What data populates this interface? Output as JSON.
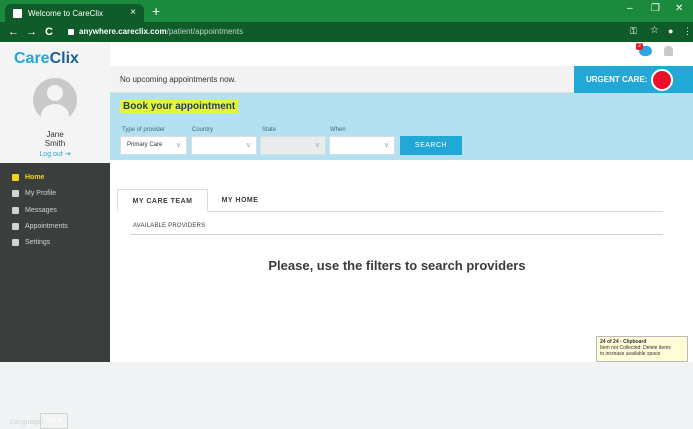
{
  "browser": {
    "tab_title": "Welcome to CareClix",
    "tab_close": "×",
    "new_tab": "+",
    "url_host": "anywhere.careclix.com",
    "url_path": "/patient/appointments",
    "minimize": "–",
    "restore": "❐",
    "close": "✕",
    "back": "←",
    "forward": "→",
    "reload": "C",
    "key": "⚿",
    "star": "☆",
    "profile": "●",
    "more": "⋮"
  },
  "sidebar": {
    "logo_a": "Care",
    "logo_b": "Clix",
    "user_first": "Jane",
    "user_last": "Smith",
    "logout": "Log out",
    "menu": [
      {
        "label": "Home"
      },
      {
        "label": "My Profile"
      },
      {
        "label": "Messages"
      },
      {
        "label": "Appointments"
      },
      {
        "label": "Settings"
      }
    ],
    "language_label": "Language:",
    "language_value": "EN ∨"
  },
  "header": {
    "notification_count": "2",
    "no_appointments": "No upcoming appointments now.",
    "urgent_care": "URGENT CARE:"
  },
  "booking": {
    "title": "Book your appointment",
    "filters": [
      {
        "label": "Type of provider",
        "value": "Primary Care"
      },
      {
        "label": "Country",
        "value": ""
      },
      {
        "label": "State",
        "value": ""
      },
      {
        "label": "When",
        "value": ""
      }
    ],
    "search_button": "SEARCH"
  },
  "providers": {
    "tabs": [
      {
        "label": "MY CARE TEAM"
      },
      {
        "label": "MY HOME"
      }
    ],
    "section_title": "AVAILABLE PROVIDERS",
    "empty_message": "Please, use the filters to search providers"
  },
  "clipboard": {
    "title": "24 of 24 - Clipboard",
    "line1": "Item not Collected: Delete items",
    "line2": "to increase available space"
  }
}
